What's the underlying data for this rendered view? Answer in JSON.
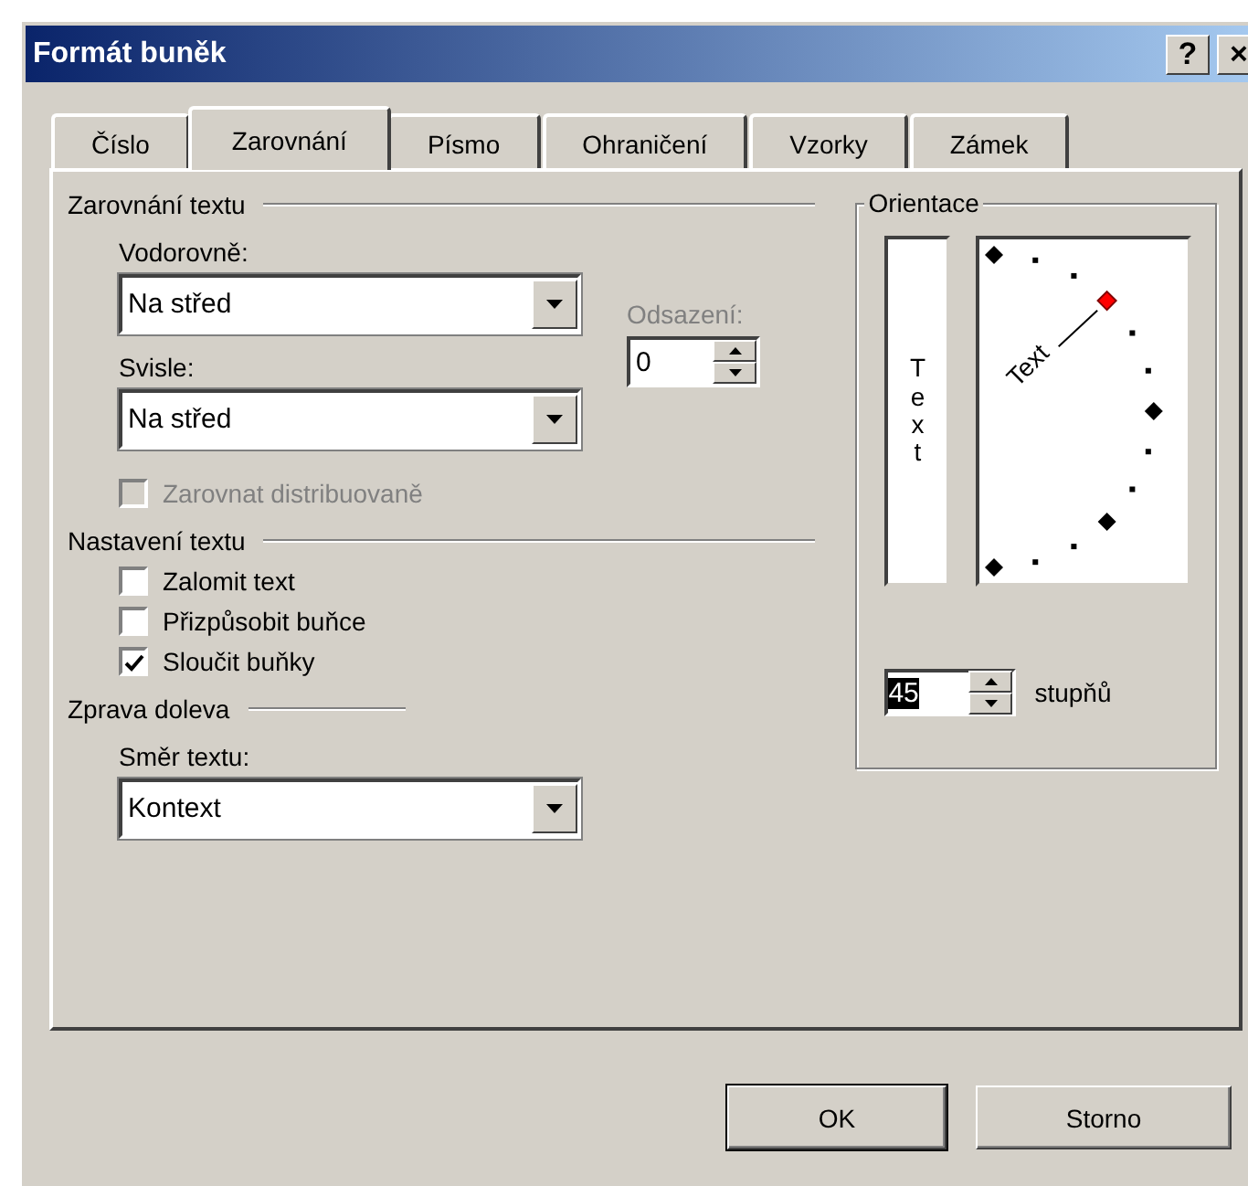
{
  "window": {
    "title": "Formát buněk",
    "help_button": "?",
    "close_button": "×"
  },
  "tabs": [
    {
      "label": "Číslo",
      "selected": false
    },
    {
      "label": "Zarovnání",
      "selected": true
    },
    {
      "label": "Písmo",
      "selected": false
    },
    {
      "label": "Ohraničení",
      "selected": false
    },
    {
      "label": "Vzorky",
      "selected": false
    },
    {
      "label": "Zámek",
      "selected": false
    }
  ],
  "alignment": {
    "heading": "Zarovnání textu",
    "horizontal": {
      "label": "Vodorovně:",
      "value": "Na střed"
    },
    "vertical": {
      "label": "Svisle:",
      "value": "Na střed"
    },
    "indent": {
      "label": "Odsazení:",
      "value": "0",
      "disabled": true
    },
    "distributed": {
      "label": "Zarovnat distribuovaně",
      "checked": false,
      "disabled": true
    }
  },
  "text_control": {
    "heading": "Nastavení textu",
    "options": [
      {
        "label": "Zalomit text",
        "checked": false
      },
      {
        "label": "Přizpůsobit buňce",
        "checked": false
      },
      {
        "label": "Sloučit buňky",
        "checked": true
      }
    ]
  },
  "rtl": {
    "heading": "Zprava doleva",
    "direction": {
      "label": "Směr textu:",
      "value": "Kontext"
    }
  },
  "orientation": {
    "heading": "Orientace",
    "vertical_text": "Text",
    "dial_text": "Text",
    "degrees": {
      "value": "45",
      "unit": "stupňů"
    }
  },
  "buttons": [
    {
      "label": "OK"
    },
    {
      "label": "Storno"
    }
  ]
}
